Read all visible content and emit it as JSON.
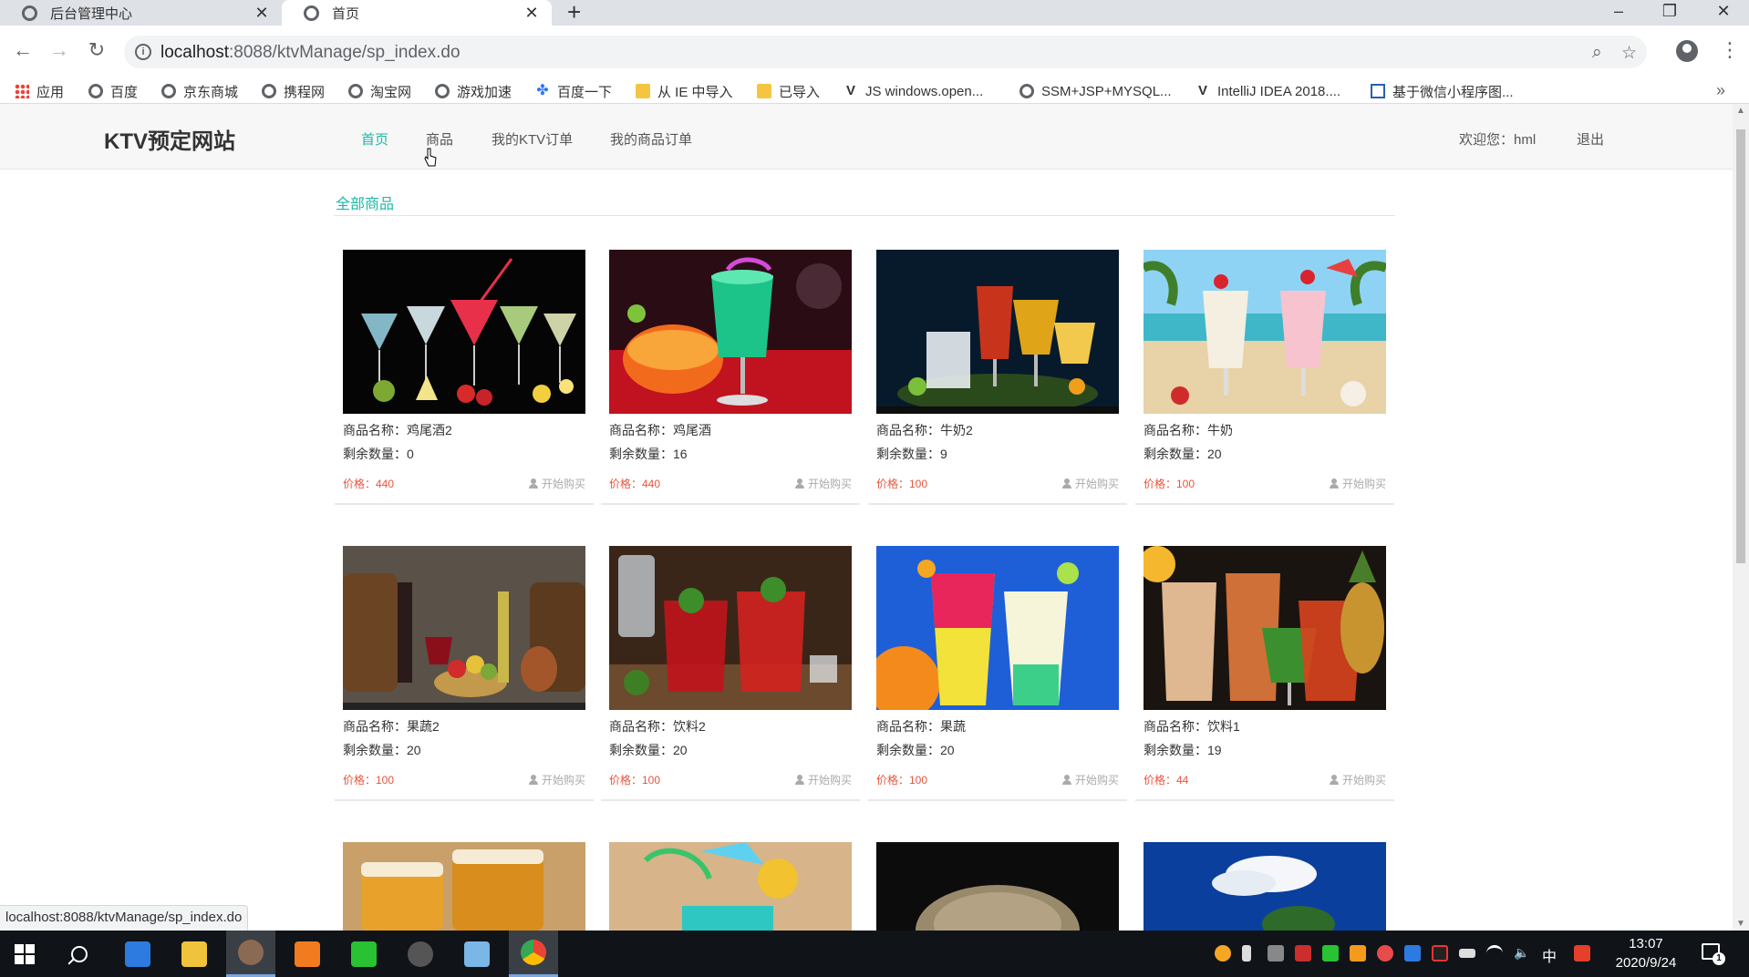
{
  "browser": {
    "tabs": [
      {
        "title": "后台管理中心",
        "active": false
      },
      {
        "title": "首页",
        "active": true
      }
    ],
    "address": {
      "host": "localhost",
      "path": ":8088/ktvManage/sp_index.do"
    },
    "bookmarks": [
      {
        "label": "应用",
        "icon": "apps-icon"
      },
      {
        "label": "百度",
        "icon": "globe-icon"
      },
      {
        "label": "京东商城",
        "icon": "globe-icon"
      },
      {
        "label": "携程网",
        "icon": "globe-icon"
      },
      {
        "label": "淘宝网",
        "icon": "globe-icon"
      },
      {
        "label": "游戏加速",
        "icon": "globe-icon"
      },
      {
        "label": "百度一下",
        "icon": "paw-icon"
      },
      {
        "label": "从 IE 中导入",
        "icon": "folder-icon"
      },
      {
        "label": "已导入",
        "icon": "folder-icon"
      },
      {
        "label": "JS windows.open...",
        "icon": "jetbrains-icon"
      },
      {
        "label": "SSM+JSP+MYSQL...",
        "icon": "globe-icon"
      },
      {
        "label": "IntelliJ IDEA 2018....",
        "icon": "jetbrains-icon"
      },
      {
        "label": "基于微信小程序图...",
        "icon": "wechat-doc-icon"
      }
    ],
    "status_url": "localhost:8088/ktvManage/sp_index.do"
  },
  "site": {
    "logo": "KTV预定网站",
    "nav": [
      {
        "label": "首页",
        "active": true
      },
      {
        "label": "商品",
        "active": false
      },
      {
        "label": "我的KTV订单",
        "active": false
      },
      {
        "label": "我的商品订单",
        "active": false
      }
    ],
    "welcome": "欢迎您：hml",
    "logout": "退出"
  },
  "section": {
    "title": "全部商品"
  },
  "products": [
    {
      "name_label": "商品名称：鸡尾酒2",
      "stock_label": "剩余数量：0",
      "price_label": "价格：440",
      "buy": "开始购买"
    },
    {
      "name_label": "商品名称：鸡尾酒",
      "stock_label": "剩余数量：16",
      "price_label": "价格：440",
      "buy": "开始购买"
    },
    {
      "name_label": "商品名称：牛奶2",
      "stock_label": "剩余数量：9",
      "price_label": "价格：100",
      "buy": "开始购买"
    },
    {
      "name_label": "商品名称：牛奶",
      "stock_label": "剩余数量：20",
      "price_label": "价格：100",
      "buy": "开始购买"
    },
    {
      "name_label": "商品名称：果蔬2",
      "stock_label": "剩余数量：20",
      "price_label": "价格：100",
      "buy": "开始购买"
    },
    {
      "name_label": "商品名称：饮料2",
      "stock_label": "剩余数量：20",
      "price_label": "价格：100",
      "buy": "开始购买"
    },
    {
      "name_label": "商品名称：果蔬",
      "stock_label": "剩余数量：20",
      "price_label": "价格：100",
      "buy": "开始购买"
    },
    {
      "name_label": "商品名称：饮料1",
      "stock_label": "剩余数量：19",
      "price_label": "价格：44",
      "buy": "开始购买"
    }
  ],
  "taskbar": {
    "ime": "中",
    "time": "13:07",
    "date": "2020/9/24",
    "notification_count": "1"
  },
  "colors": {
    "accent": "#1ab8a6",
    "price": "#e8543d"
  }
}
